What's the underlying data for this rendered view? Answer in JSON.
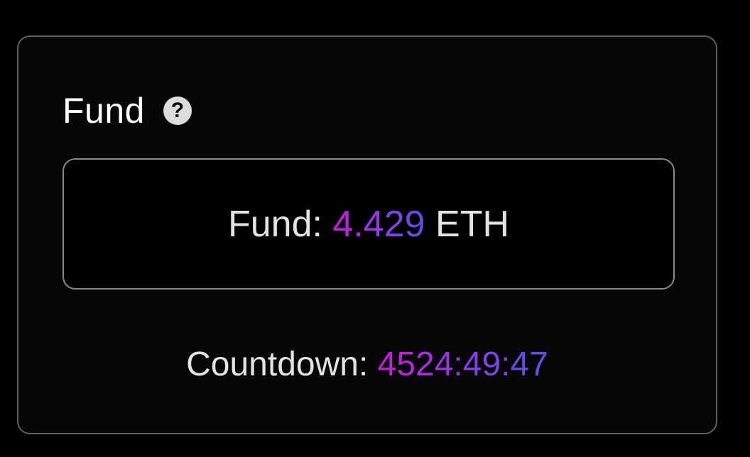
{
  "card": {
    "title": "Fund",
    "help_icon": "question-circle-icon"
  },
  "fund": {
    "label": "Fund:",
    "value": "4.429",
    "unit": "ETH"
  },
  "countdown": {
    "label": "Countdown:",
    "value": "4524:49:47"
  },
  "colors": {
    "background": "#000000",
    "card_background": "#070707",
    "card_border": "#5f5f5f",
    "box_border": "#8a8a8a",
    "text": "#e3e3e3",
    "gradient_start": "#c81bd8",
    "gradient_end": "#5a4fe0"
  }
}
